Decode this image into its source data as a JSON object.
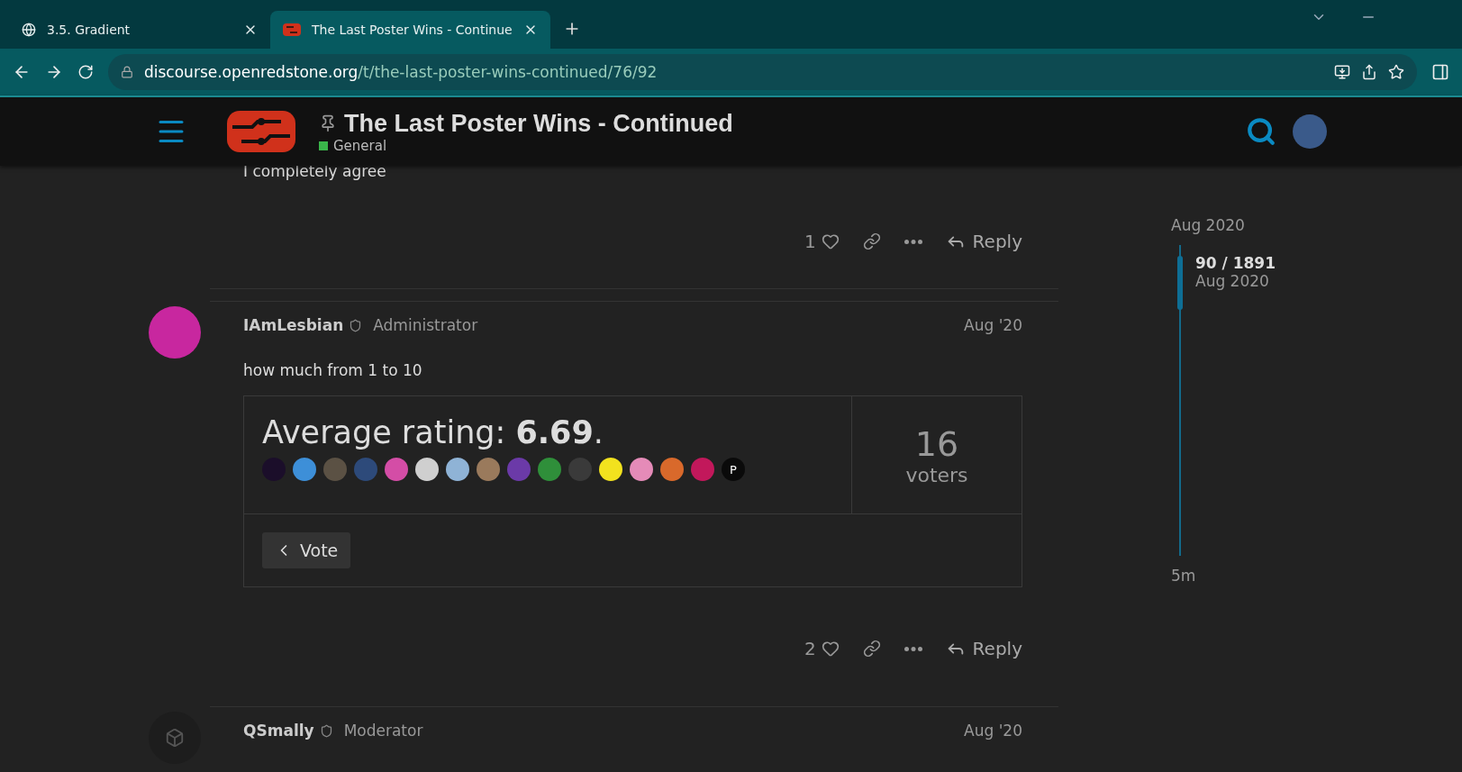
{
  "browser": {
    "tabs": [
      {
        "title": "3.5. Gradient",
        "selected": false
      },
      {
        "title": "The Last Poster Wins - Continue",
        "selected": true
      }
    ],
    "url_host": "discourse.openredstone.org",
    "url_path": "/t/the-last-poster-wins-continued/76/92"
  },
  "header": {
    "title": "The Last Poster Wins - Continued",
    "category": {
      "name": "General",
      "color": "#3ab54a"
    }
  },
  "posts": [
    {
      "kind": "tail",
      "body": "I completely agree",
      "likes": "1",
      "reply": "Reply"
    },
    {
      "kind": "full",
      "username": "IAmLesbian",
      "role": "Administrator",
      "date": "Aug '20",
      "body": "how much from 1 to 10",
      "poll": {
        "label": "Average rating: ",
        "value": "6.69",
        "suffix": ".",
        "count": "16",
        "count_label": "voters",
        "button": "Vote",
        "voters": [
          {
            "color": "#1b0e2a"
          },
          {
            "color": "#3d8fd8"
          },
          {
            "color": "#5b5144"
          },
          {
            "color": "#2d4a7a"
          },
          {
            "color": "#d44da6"
          },
          {
            "color": "#cfcfcf"
          },
          {
            "color": "#8fb3d6"
          },
          {
            "color": "#9a7a5c"
          },
          {
            "color": "#6b3aa8"
          },
          {
            "color": "#2f8f3a"
          },
          {
            "color": "#3a3a3a"
          },
          {
            "color": "#f2e21e"
          },
          {
            "color": "#e58bb8"
          },
          {
            "color": "#d9692b"
          },
          {
            "color": "#c2185b"
          },
          {
            "color": "#0a0a0a",
            "initial": "P"
          }
        ]
      },
      "likes": "2",
      "reply": "Reply"
    },
    {
      "kind": "head",
      "username": "QSmally",
      "role": "Moderator",
      "date": "Aug '20"
    }
  ],
  "timeline": {
    "start": "Aug 2020",
    "position": "90 / 1891",
    "position_date": "Aug 2020",
    "end": "5m"
  }
}
